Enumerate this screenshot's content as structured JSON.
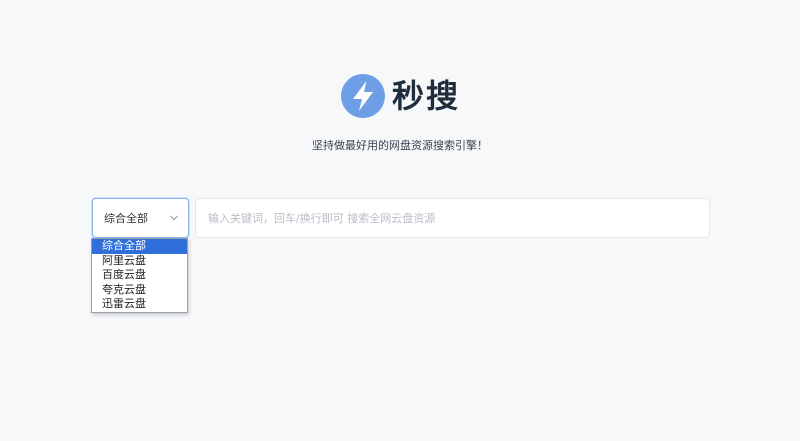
{
  "brand": {
    "name": "秒搜",
    "logo_color": "#6d9ee6"
  },
  "tagline": "坚持做最好用的网盘资源搜索引擎！",
  "search": {
    "selected_type": "综合全部",
    "placeholder": "输入关键词，回车/换行即可 搜索全网云盘资源",
    "value": ""
  },
  "dropdown": {
    "options": [
      "综合全部",
      "阿里云盘",
      "百度云盘",
      "夸克云盘",
      "迅雷云盘"
    ],
    "selected_index": 0,
    "highlight_color": "#2f6fd9"
  }
}
